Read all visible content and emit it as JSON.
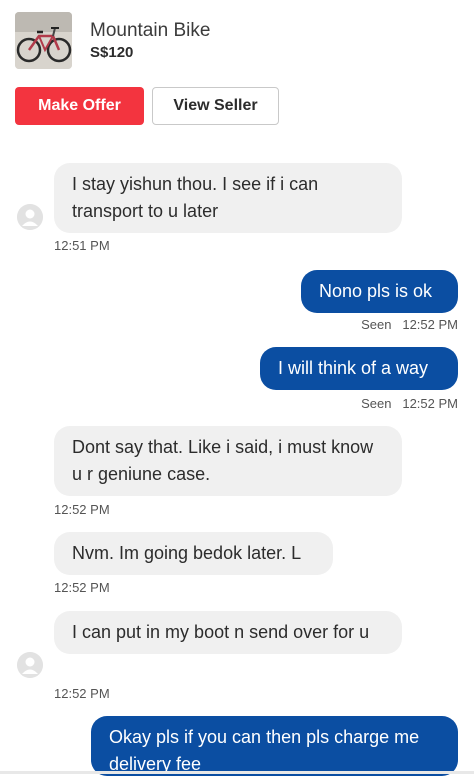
{
  "listing": {
    "title": "Mountain Bike",
    "price": "S$120",
    "thumbnail_icon": "bicycle-photo"
  },
  "actions": {
    "make_offer": "Make Offer",
    "view_seller": "View Seller"
  },
  "messages": [
    {
      "from": "seller",
      "text": "I stay yishun thou. I see if i can transport to u later",
      "time": "12:51 PM"
    },
    {
      "from": "me",
      "text": "Nono pls is ok",
      "seen": "Seen",
      "time": "12:52 PM"
    },
    {
      "from": "me",
      "text": "I will think of a way",
      "seen": "Seen",
      "time": "12:52 PM"
    },
    {
      "from": "seller",
      "text": "Dont say that. Like i said, i must know u r geniune case.",
      "time": "12:52 PM"
    },
    {
      "from": "seller",
      "text": "Nvm. Im going bedok later. L",
      "time": "12:52 PM"
    },
    {
      "from": "seller",
      "text": "I can put in my boot n send over for u",
      "time": "12:52 PM"
    },
    {
      "from": "me",
      "text": "Okay pls if you can then pls charge me delivery fee"
    }
  ],
  "colors": {
    "offer_button": "#f3343f",
    "outgoing_bubble": "#0b4ea2",
    "incoming_bubble": "#f0f0f0"
  }
}
